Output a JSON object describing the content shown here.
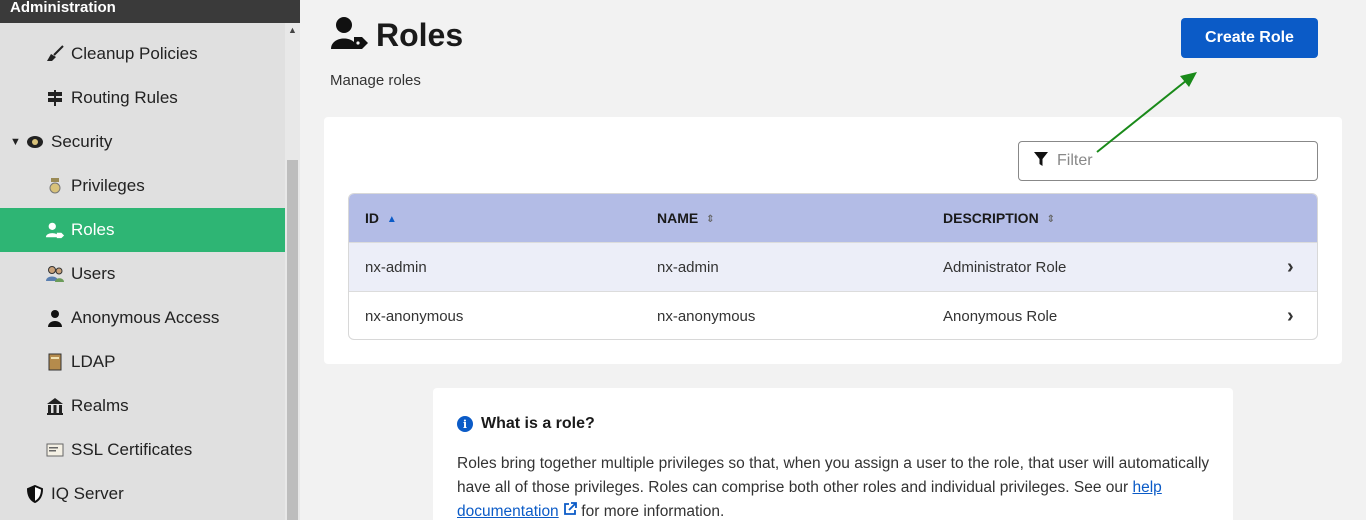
{
  "sidebar": {
    "header": "Administration",
    "items": [
      {
        "label": "Cleanup Policies",
        "icon": "broom-icon"
      },
      {
        "label": "Routing Rules",
        "icon": "signpost-icon"
      },
      {
        "label": "Security",
        "icon": "badge-icon"
      },
      {
        "label": "Privileges",
        "icon": "medal-icon"
      },
      {
        "label": "Roles",
        "icon": "user-tag-icon"
      },
      {
        "label": "Users",
        "icon": "users-icon"
      },
      {
        "label": "Anonymous Access",
        "icon": "user-icon"
      },
      {
        "label": "LDAP",
        "icon": "book-icon"
      },
      {
        "label": "Realms",
        "icon": "realm-icon"
      },
      {
        "label": "SSL Certificates",
        "icon": "certificate-icon"
      },
      {
        "label": "IQ Server",
        "icon": "shield-icon"
      }
    ]
  },
  "page": {
    "title": "Roles",
    "subtitle": "Manage roles",
    "create_button": "Create Role"
  },
  "filter": {
    "placeholder": "Filter"
  },
  "table": {
    "headers": [
      "ID",
      "NAME",
      "DESCRIPTION"
    ],
    "rows": [
      {
        "id": "nx-admin",
        "name": "nx-admin",
        "description": "Administrator Role"
      },
      {
        "id": "nx-anonymous",
        "name": "nx-anonymous",
        "description": "Anonymous Role"
      }
    ]
  },
  "info": {
    "title": "What is a role?",
    "text_before": "Roles bring together multiple privileges so that, when you assign a user to the role, that user will automatically have all of those privileges. Roles can comprise both other roles and individual privileges. See our ",
    "link": "help documentation",
    "text_after": " for more information."
  },
  "colors": {
    "active": "#2eb574",
    "primary": "#0b5bc7",
    "table_header": "#b3bce6",
    "arrow": "#1a8a1a"
  }
}
